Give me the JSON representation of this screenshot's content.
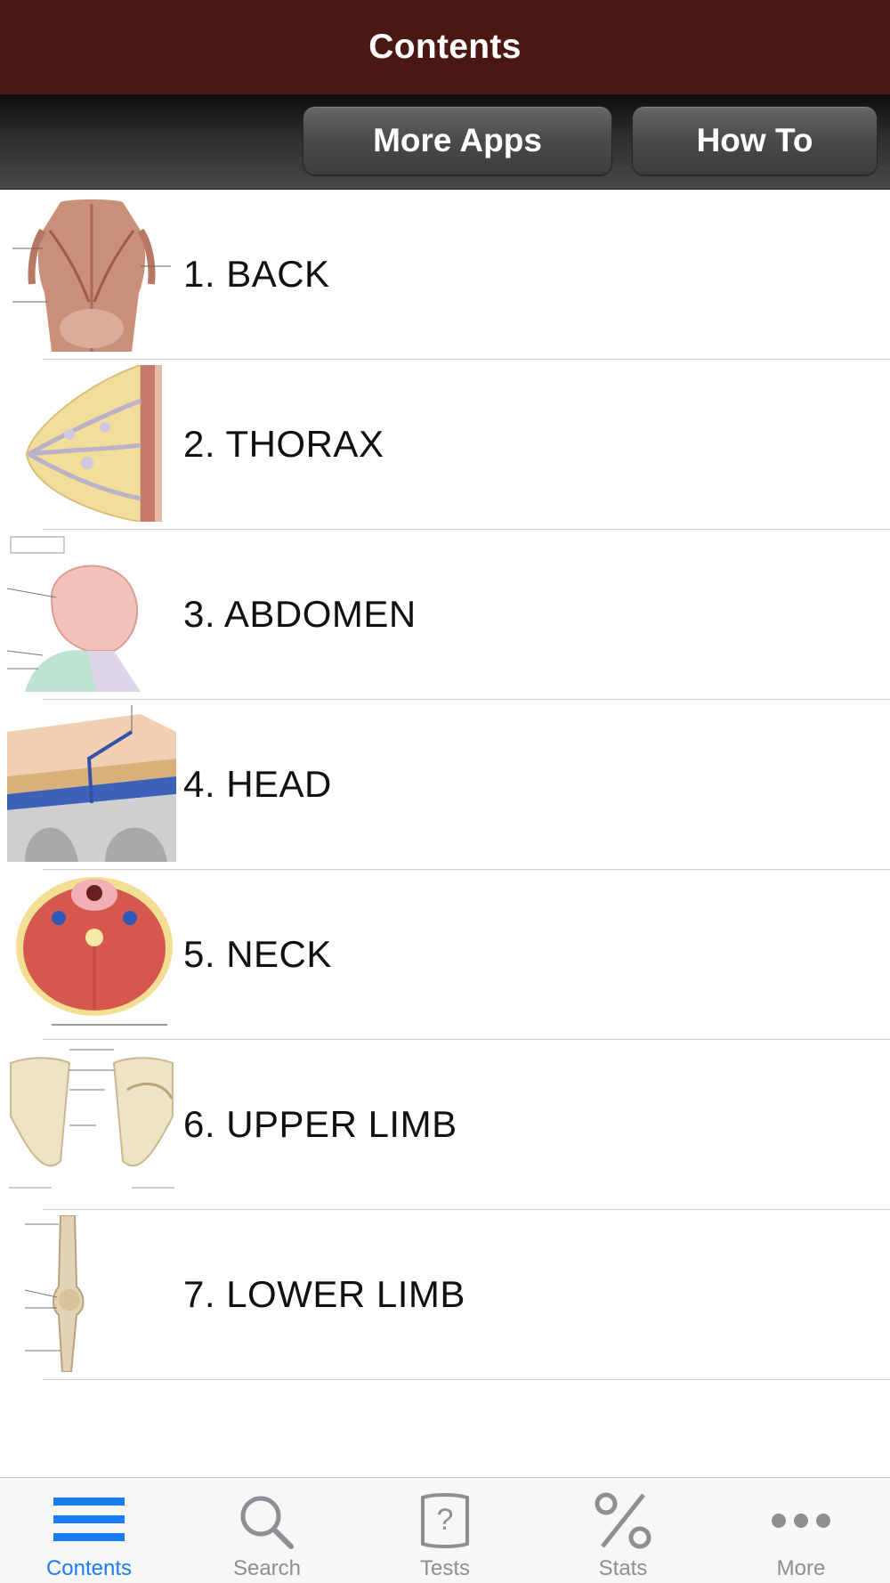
{
  "header": {
    "title": "Contents"
  },
  "toolbar": {
    "more_apps_label": "More Apps",
    "how_to_label": "How To"
  },
  "chapters": [
    {
      "label": "1. BACK",
      "icon": "back-anatomy-thumbnail"
    },
    {
      "label": "2. THORAX",
      "icon": "breast-anatomy-thumbnail"
    },
    {
      "label": "3. ABDOMEN",
      "icon": "abdomen-anatomy-thumbnail"
    },
    {
      "label": "4. HEAD",
      "icon": "scalp-section-thumbnail"
    },
    {
      "label": "5. NECK",
      "icon": "neck-cross-section-thumbnail"
    },
    {
      "label": "6. UPPER LIMB",
      "icon": "scapula-thumbnail"
    },
    {
      "label": "7. LOWER LIMB",
      "icon": "knee-bones-thumbnail"
    }
  ],
  "tabbar": {
    "tabs": [
      {
        "label": "Contents",
        "icon": "list-icon",
        "active": true
      },
      {
        "label": "Search",
        "icon": "search-icon",
        "active": false
      },
      {
        "label": "Tests",
        "icon": "question-card-icon",
        "active": false
      },
      {
        "label": "Stats",
        "icon": "percent-icon",
        "active": false
      },
      {
        "label": "More",
        "icon": "more-dots-icon",
        "active": false
      }
    ]
  },
  "colors": {
    "header_bg": "#4a1712",
    "accent": "#1a7cf2",
    "inactive": "#8e8e93"
  }
}
